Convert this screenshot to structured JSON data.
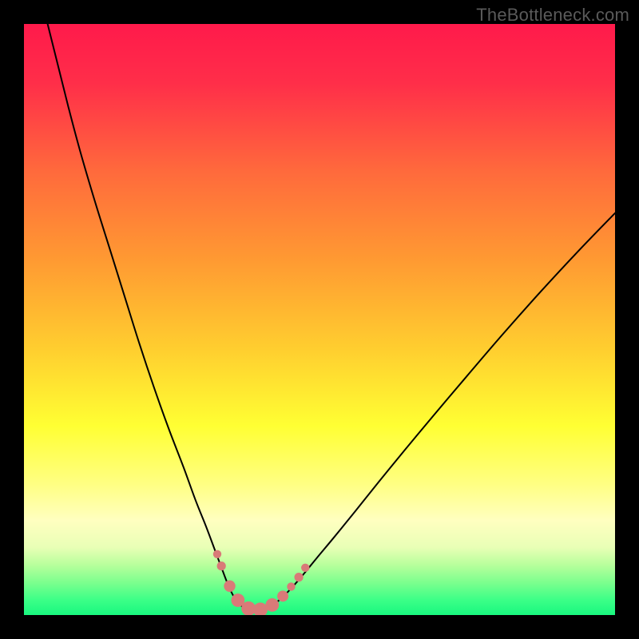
{
  "watermark": {
    "text": "TheBottleneck.com"
  },
  "chart_data": {
    "type": "line",
    "title": "",
    "xlabel": "",
    "ylabel": "",
    "x_range": [
      0,
      100
    ],
    "y_range": [
      0,
      100
    ],
    "gradient_stops": [
      {
        "offset": 0,
        "color": "#ff1a4b"
      },
      {
        "offset": 0.1,
        "color": "#ff2e49"
      },
      {
        "offset": 0.25,
        "color": "#ff6a3c"
      },
      {
        "offset": 0.4,
        "color": "#ff9a32"
      },
      {
        "offset": 0.55,
        "color": "#ffce2f"
      },
      {
        "offset": 0.68,
        "color": "#ffff33"
      },
      {
        "offset": 0.78,
        "color": "#ffff84"
      },
      {
        "offset": 0.84,
        "color": "#ffffc0"
      },
      {
        "offset": 0.885,
        "color": "#e9ffb6"
      },
      {
        "offset": 0.915,
        "color": "#b8ff9c"
      },
      {
        "offset": 0.945,
        "color": "#7cff8e"
      },
      {
        "offset": 0.975,
        "color": "#3bff87"
      },
      {
        "offset": 1.0,
        "color": "#19f77f"
      }
    ],
    "series": [
      {
        "name": "left-curve",
        "stroke": "#000000",
        "stroke_width": 2.0,
        "points": [
          {
            "x": 4.0,
            "y": 100.0
          },
          {
            "x": 5.5,
            "y": 94.0
          },
          {
            "x": 7.5,
            "y": 86.0
          },
          {
            "x": 9.5,
            "y": 78.5
          },
          {
            "x": 12.0,
            "y": 70.0
          },
          {
            "x": 14.5,
            "y": 62.0
          },
          {
            "x": 17.0,
            "y": 54.0
          },
          {
            "x": 19.5,
            "y": 46.0
          },
          {
            "x": 22.0,
            "y": 38.5
          },
          {
            "x": 24.5,
            "y": 31.5
          },
          {
            "x": 27.0,
            "y": 25.0
          },
          {
            "x": 29.0,
            "y": 19.5
          },
          {
            "x": 30.8,
            "y": 15.0
          },
          {
            "x": 32.3,
            "y": 11.0
          },
          {
            "x": 33.5,
            "y": 7.8
          },
          {
            "x": 34.5,
            "y": 5.2
          },
          {
            "x": 35.4,
            "y": 3.3
          },
          {
            "x": 36.5,
            "y": 1.8
          },
          {
            "x": 37.8,
            "y": 0.9
          },
          {
            "x": 39.0,
            "y": 0.6
          }
        ]
      },
      {
        "name": "right-curve",
        "stroke": "#000000",
        "stroke_width": 2.0,
        "points": [
          {
            "x": 39.0,
            "y": 0.6
          },
          {
            "x": 40.5,
            "y": 0.85
          },
          {
            "x": 42.0,
            "y": 1.6
          },
          {
            "x": 43.5,
            "y": 2.8
          },
          {
            "x": 45.2,
            "y": 4.5
          },
          {
            "x": 47.2,
            "y": 6.8
          },
          {
            "x": 49.5,
            "y": 9.6
          },
          {
            "x": 52.5,
            "y": 13.2
          },
          {
            "x": 56.0,
            "y": 17.5
          },
          {
            "x": 60.0,
            "y": 22.5
          },
          {
            "x": 64.5,
            "y": 28.0
          },
          {
            "x": 69.5,
            "y": 34.0
          },
          {
            "x": 75.0,
            "y": 40.5
          },
          {
            "x": 81.0,
            "y": 47.5
          },
          {
            "x": 87.5,
            "y": 54.8
          },
          {
            "x": 94.0,
            "y": 61.8
          },
          {
            "x": 100.0,
            "y": 68.0
          }
        ]
      }
    ],
    "markers": {
      "fill": "#d97a78",
      "stroke": "#c56562",
      "points": [
        {
          "x": 32.7,
          "y": 10.3,
          "r": 5.2
        },
        {
          "x": 33.4,
          "y": 8.3,
          "r": 5.6
        },
        {
          "x": 34.8,
          "y": 4.9,
          "r": 7.2
        },
        {
          "x": 36.2,
          "y": 2.5,
          "r": 8.4
        },
        {
          "x": 38.0,
          "y": 1.1,
          "r": 9.0
        },
        {
          "x": 40.0,
          "y": 0.9,
          "r": 9.0
        },
        {
          "x": 42.0,
          "y": 1.7,
          "r": 8.4
        },
        {
          "x": 43.8,
          "y": 3.2,
          "r": 7.0
        },
        {
          "x": 45.2,
          "y": 4.8,
          "r": 5.2
        },
        {
          "x": 46.5,
          "y": 6.4,
          "r": 5.6
        },
        {
          "x": 47.6,
          "y": 8.0,
          "r": 5.2
        }
      ]
    }
  }
}
